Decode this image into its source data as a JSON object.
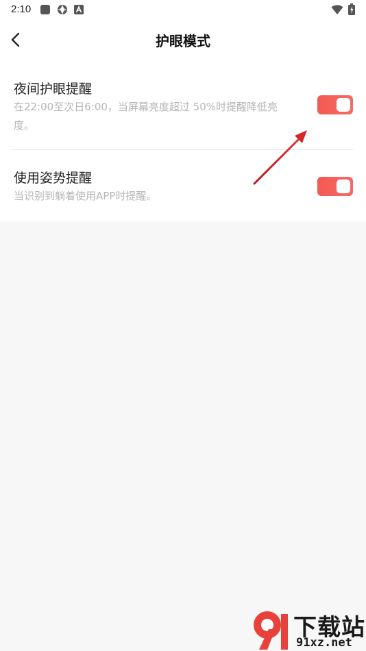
{
  "status_bar": {
    "time": "2:10",
    "icons": [
      "square-notification-icon",
      "aperture-icon",
      "a-badge-icon",
      "wifi-icon",
      "battery-charging-icon"
    ]
  },
  "app_bar": {
    "back_icon": "chevron-left-icon",
    "title": "护眼模式"
  },
  "settings": [
    {
      "title": "夜间护眼提醒",
      "description": "在22:00至次日6:00，当屏幕亮度超过 50%时提醒降低亮度。",
      "enabled": true
    },
    {
      "title": "使用姿势提醒",
      "description": "当识别到躺着使用APP时提醒。",
      "enabled": true
    }
  ],
  "colors": {
    "toggle_on": "#f25a52",
    "background": "#f7f7f7",
    "card": "#ffffff",
    "annotation_arrow": "#d42a2a"
  },
  "watermark": {
    "logo_text": "9",
    "cn": "下载站",
    "en": "91xz.net"
  }
}
